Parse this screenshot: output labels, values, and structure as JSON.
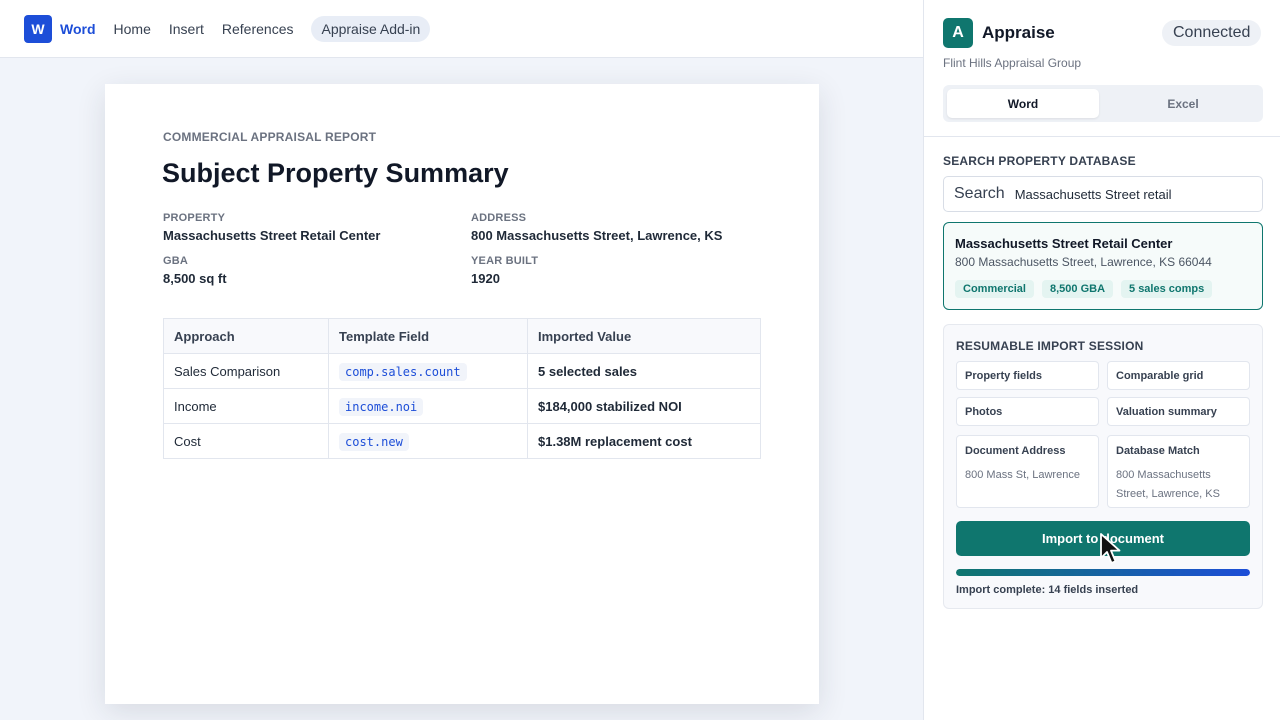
{
  "word": {
    "logo": "W",
    "app_name": "Word",
    "menu": [
      "Home",
      "Insert",
      "References"
    ],
    "addin_tab": "Appraise Add-in"
  },
  "document": {
    "eyebrow": "COMMERCIAL APPRAISAL REPORT",
    "title": "Subject Property Summary",
    "fields": {
      "property_label": "PROPERTY",
      "property_value": "Massachusetts Street Retail Center",
      "address_label": "ADDRESS",
      "address_value": "800 Massachusetts Street, Lawrence, KS",
      "gba_label": "GBA",
      "gba_value": "8,500 sq ft",
      "year_label": "YEAR BUILT",
      "year_value": "1920"
    },
    "table": {
      "headers": [
        "Approach",
        "Template Field",
        "Imported Value"
      ],
      "rows": [
        [
          "Sales Comparison",
          "comp.sales.count",
          "5 selected sales"
        ],
        [
          "Income",
          "income.noi",
          "$184,000 stabilized NOI"
        ],
        [
          "Cost",
          "cost.new",
          "$1.38M replacement cost"
        ]
      ]
    }
  },
  "pane": {
    "logo": "A",
    "app_name": "Appraise",
    "connection": "Connected",
    "org": "Flint Hills Appraisal Group",
    "tabs": [
      "Word",
      "Excel"
    ],
    "search": {
      "section_label": "SEARCH PROPERTY DATABASE",
      "label": "Search",
      "value": "Massachusetts Street retail"
    },
    "result": {
      "title": "Massachusetts Street Retail Center",
      "address": "800 Massachusetts Street, Lawrence, KS 66044",
      "tags": [
        "Commercial",
        "8,500 GBA",
        "5 sales comps"
      ]
    },
    "session": {
      "title": "RESUMABLE IMPORT SESSION",
      "chips": [
        "Property fields",
        "Comparable grid",
        "Photos",
        "Valuation summary"
      ],
      "doc_address_label": "Document Address",
      "doc_address_value": "800 Mass St, Lawrence",
      "db_match_label": "Database Match",
      "db_match_value": "800 Massachusetts Street, Lawrence, KS",
      "import_button": "Import to document",
      "progress_percent": 100,
      "status": "Import complete: 14 fields inserted"
    }
  },
  "colors": {
    "word_blue": "#1d4ed8",
    "appraise_teal": "#0f766e"
  }
}
